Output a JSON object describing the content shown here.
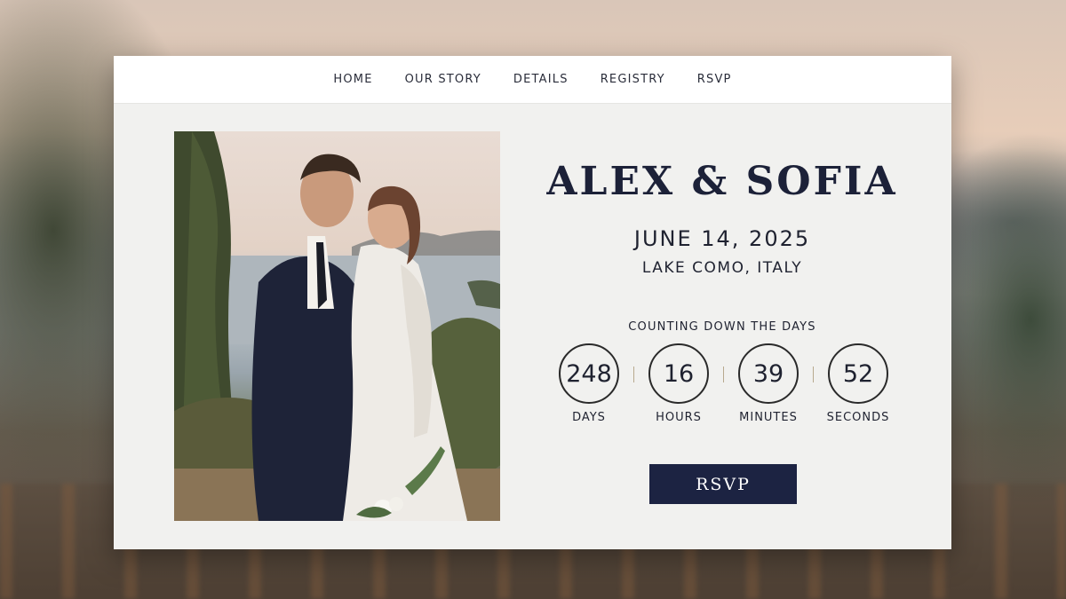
{
  "nav": {
    "items": [
      {
        "label": "HOME"
      },
      {
        "label": "OUR STORY"
      },
      {
        "label": "DETAILS"
      },
      {
        "label": "REGISTRY"
      },
      {
        "label": "RSVP"
      }
    ]
  },
  "hero": {
    "names": "ALEX & SOFIA",
    "date": "JUNE 14, 2025",
    "location": "LAKE COMO, ITALY"
  },
  "countdown": {
    "title": "COUNTING DOWN THE DAYS",
    "units": [
      {
        "value": "248",
        "label": "DAYS"
      },
      {
        "value": "16",
        "label": "HOURS"
      },
      {
        "value": "39",
        "label": "MINUTES"
      },
      {
        "value": "52",
        "label": "SECONDS"
      }
    ]
  },
  "actions": {
    "rsvp_label": "RSVP"
  },
  "colors": {
    "accent": "#1c2342",
    "separator": "#b8a98e",
    "card": "#f1f1ef"
  }
}
